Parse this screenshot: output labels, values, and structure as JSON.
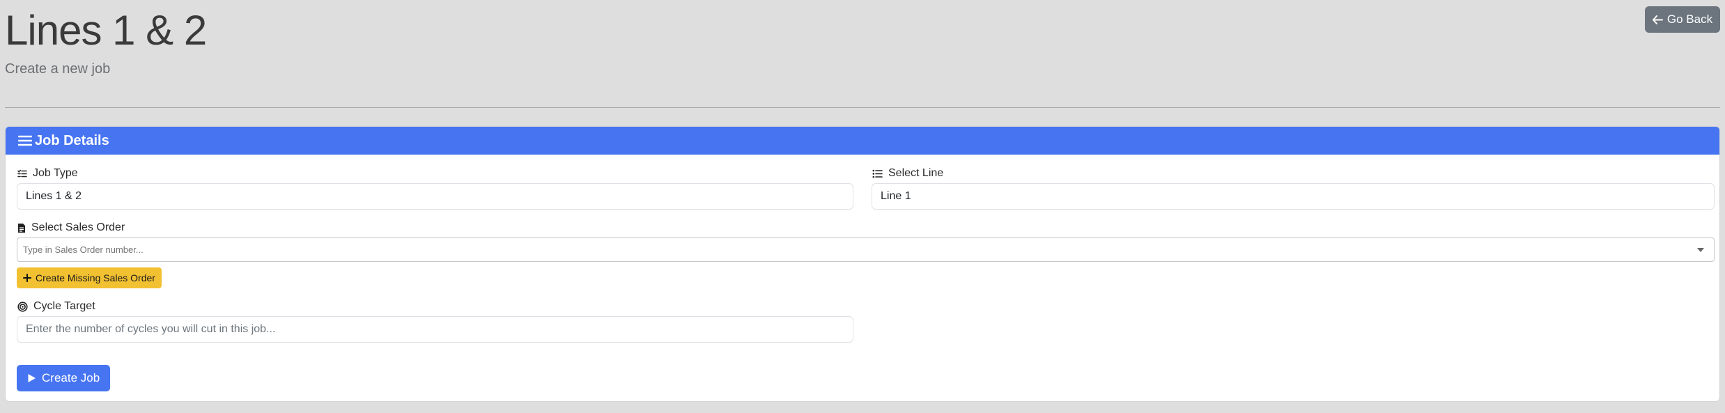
{
  "header": {
    "title": "Lines 1 & 2",
    "subtitle": "Create a new job",
    "back_label": "Go Back"
  },
  "card": {
    "title": "Job Details"
  },
  "job_type": {
    "label": "Job Type",
    "value": "Lines 1 & 2"
  },
  "select_line": {
    "label": "Select Line",
    "value": "Line 1"
  },
  "sales_order": {
    "label": "Select Sales Order",
    "placeholder": "Type in Sales Order number...",
    "create_missing_label": "Create Missing Sales Order"
  },
  "cycle_target": {
    "label": "Cycle Target",
    "placeholder": "Enter the number of cycles you will cut in this job..."
  },
  "create_job_label": "Create Job",
  "colors": {
    "primary": "#4775f2",
    "warning": "#f2c132",
    "secondary": "#6c757d",
    "background": "#dedede"
  },
  "icons": {
    "back": "arrow-left-icon",
    "card": "list-icon",
    "job_type": "list-check-icon",
    "select_line": "list-ul-icon",
    "sales_order": "file-text-icon",
    "create_missing": "plus-icon",
    "cycle_target": "target-icon",
    "create_job": "play-icon",
    "dropdown": "chevron-down-icon"
  }
}
